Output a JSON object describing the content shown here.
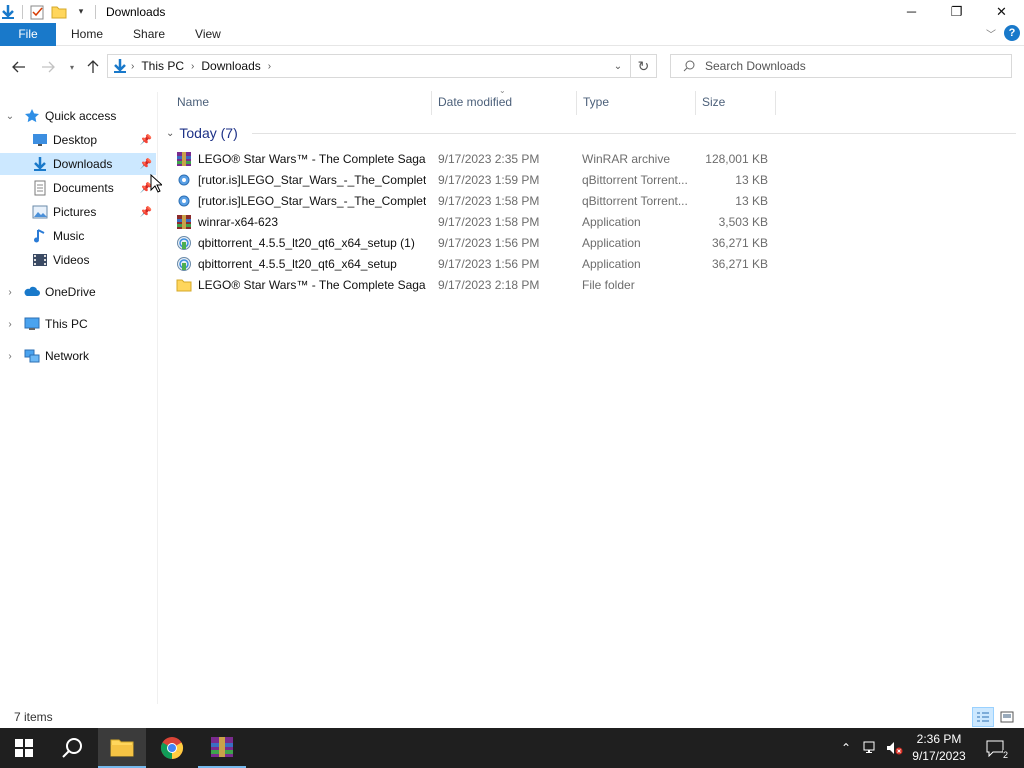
{
  "window": {
    "title": "Downloads",
    "controls": {
      "minimize": "─",
      "restore": "❐",
      "close": "✕"
    }
  },
  "ribbon": {
    "file_tab": "File",
    "tabs": [
      "Home",
      "Share",
      "View"
    ],
    "help": "?"
  },
  "address": {
    "crumbs": [
      "This PC",
      "Downloads"
    ],
    "search_placeholder": "Search Downloads"
  },
  "nav_pane": {
    "quick_access": "Quick access",
    "pinned": [
      {
        "label": "Desktop",
        "icon": "desktop-icon",
        "pinned": true
      },
      {
        "label": "Downloads",
        "icon": "downloads-icon",
        "pinned": true,
        "selected": true
      },
      {
        "label": "Documents",
        "icon": "documents-icon",
        "pinned": true
      },
      {
        "label": "Pictures",
        "icon": "pictures-icon",
        "pinned": true
      },
      {
        "label": "Music",
        "icon": "music-icon",
        "pinned": false
      },
      {
        "label": "Videos",
        "icon": "videos-icon",
        "pinned": false
      }
    ],
    "roots": [
      {
        "label": "OneDrive",
        "icon": "onedrive-icon"
      },
      {
        "label": "This PC",
        "icon": "this-pc-icon"
      },
      {
        "label": "Network",
        "icon": "network-icon"
      }
    ]
  },
  "columns": {
    "name": "Name",
    "date": "Date modified",
    "type": "Type",
    "size": "Size"
  },
  "group": {
    "label": "Today (7)"
  },
  "files": [
    {
      "name": "LEGO® Star Wars™ - The Complete Saga ...",
      "date": "9/17/2023 2:35 PM",
      "type": "WinRAR archive",
      "size": "128,001 KB",
      "icon": "winrar-archive-icon"
    },
    {
      "name": "[rutor.is]LEGO_Star_Wars_-_The_Complet...",
      "date": "9/17/2023 1:59 PM",
      "type": "qBittorrent Torrent...",
      "size": "13 KB",
      "icon": "torrent-file-icon"
    },
    {
      "name": "[rutor.is]LEGO_Star_Wars_-_The_Complet...",
      "date": "9/17/2023 1:58 PM",
      "type": "qBittorrent Torrent...",
      "size": "13 KB",
      "icon": "torrent-file-icon"
    },
    {
      "name": "winrar-x64-623",
      "date": "9/17/2023 1:58 PM",
      "type": "Application",
      "size": "3,503 KB",
      "icon": "winrar-installer-icon"
    },
    {
      "name": "qbittorrent_4.5.5_lt20_qt6_x64_setup (1)",
      "date": "9/17/2023 1:56 PM",
      "type": "Application",
      "size": "36,271 KB",
      "icon": "qbittorrent-installer-icon"
    },
    {
      "name": "qbittorrent_4.5.5_lt20_qt6_x64_setup",
      "date": "9/17/2023 1:56 PM",
      "type": "Application",
      "size": "36,271 KB",
      "icon": "qbittorrent-installer-icon"
    },
    {
      "name": "LEGO® Star Wars™ - The Complete Saga ...",
      "date": "9/17/2023 2:18 PM",
      "type": "File folder",
      "size": "",
      "icon": "folder-icon"
    }
  ],
  "status": {
    "items": "7 items"
  },
  "taskbar": {
    "clock_time": "2:36 PM",
    "clock_date": "9/17/2023",
    "notification_count": "2"
  },
  "colors": {
    "accent": "#1979ca",
    "selection": "#cce8ff",
    "group_header": "#1e3287",
    "taskbar": "#1f1f1f"
  }
}
